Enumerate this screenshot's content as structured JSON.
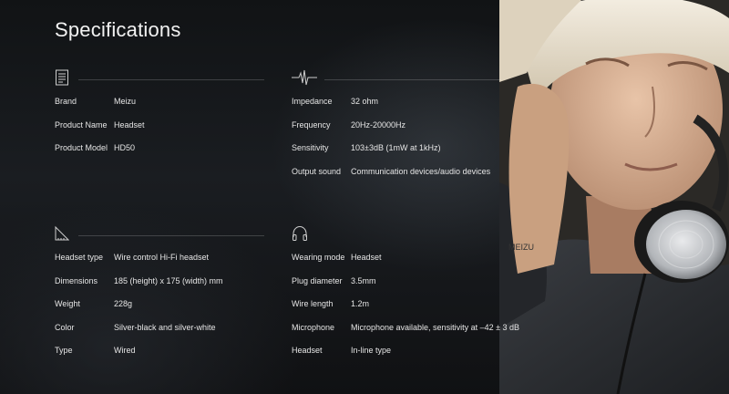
{
  "title": "Specifications",
  "sections": {
    "basic": {
      "icon": "document-icon",
      "rows": [
        {
          "label": "Brand",
          "value": "Meizu"
        },
        {
          "label": "Product Name",
          "value": "Headset"
        },
        {
          "label": "Product Model",
          "value": "HD50"
        }
      ]
    },
    "audio": {
      "icon": "waveform-icon",
      "rows": [
        {
          "label": "Impedance",
          "value": "32 ohm"
        },
        {
          "label": "Frequency",
          "value": "20Hz-20000Hz"
        },
        {
          "label": "Sensitivity",
          "value": "103±3dB (1mW at 1kHz)"
        },
        {
          "label": "Output sound",
          "value": "Communication devices/audio devices"
        }
      ]
    },
    "physical": {
      "icon": "ruler-triangle-icon",
      "rows": [
        {
          "label": "Headset type",
          "value": "Wire control Hi-Fi headset"
        },
        {
          "label": "Dimensions",
          "value": "185 (height) x 175 (width) mm"
        },
        {
          "label": "Weight",
          "value": "228g"
        },
        {
          "label": "Color",
          "value": "Silver-black and silver-white"
        },
        {
          "label": "Type",
          "value": "Wired"
        }
      ]
    },
    "wearing": {
      "icon": "headphones-icon",
      "rows": [
        {
          "label": "Wearing mode",
          "value": "Headset"
        },
        {
          "label": "Plug diameter",
          "value": "3.5mm"
        },
        {
          "label": "Wire length",
          "value": "1.2m"
        },
        {
          "label": "Microphone",
          "value": "Microphone available, sensitivity at –42 ± 3 dB"
        },
        {
          "label": "Headset",
          "value": "In-line type"
        }
      ]
    }
  },
  "photo": {
    "headphone_brand": "MEIZU"
  }
}
